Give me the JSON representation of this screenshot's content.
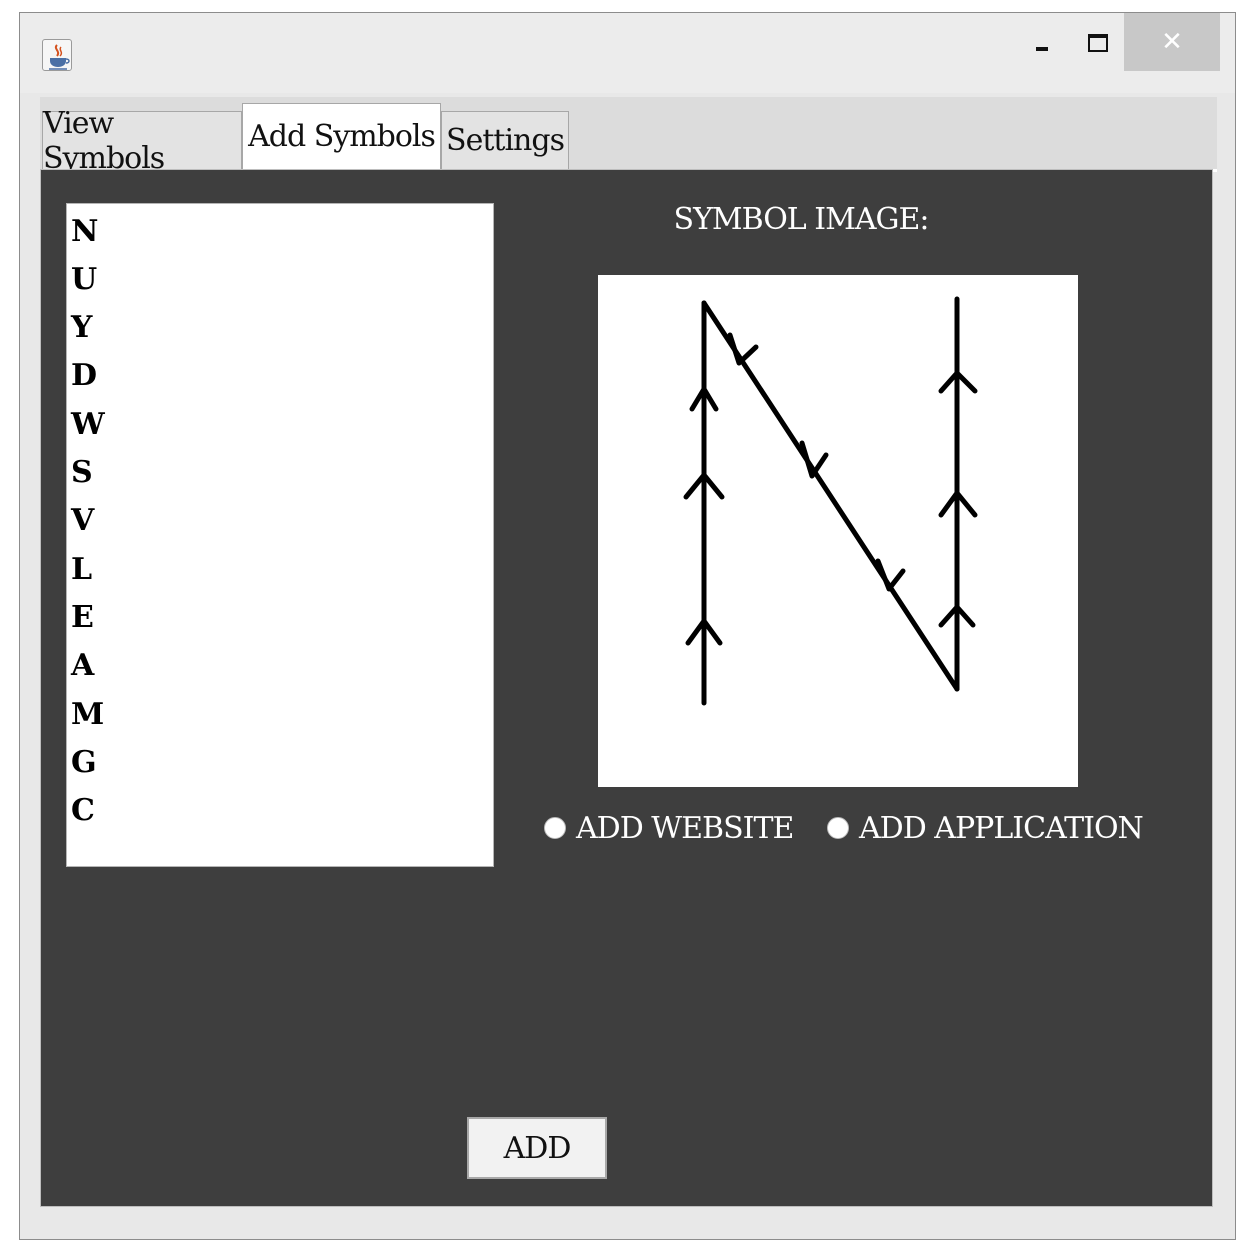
{
  "window": {
    "icon": "java-cup-icon",
    "controls": {
      "minimize": "minimize-icon",
      "maximize": "maximize-icon",
      "close": "✕"
    }
  },
  "tabs": [
    {
      "label": "View Symbols",
      "active": false
    },
    {
      "label": "Add Symbols",
      "active": true
    },
    {
      "label": "Settings",
      "active": false
    }
  ],
  "symbol_list": [
    "N",
    "U",
    "Y",
    "D",
    "W",
    "S",
    "V",
    "L",
    "E",
    "A",
    "M",
    "G",
    "C"
  ],
  "symbol_image": {
    "label": "SYMBOL IMAGE:",
    "letter_drawn": "N",
    "colors": {
      "background": "#ffffff",
      "stroke": "#000000"
    }
  },
  "options": {
    "website": "ADD WEBSITE",
    "application": "ADD APPLICATION"
  },
  "add_button": "ADD",
  "colors": {
    "panel_bg": "#3e3e3e",
    "window_bg": "#e8e8e8",
    "tabstrip_bg": "#dcdcdc"
  }
}
